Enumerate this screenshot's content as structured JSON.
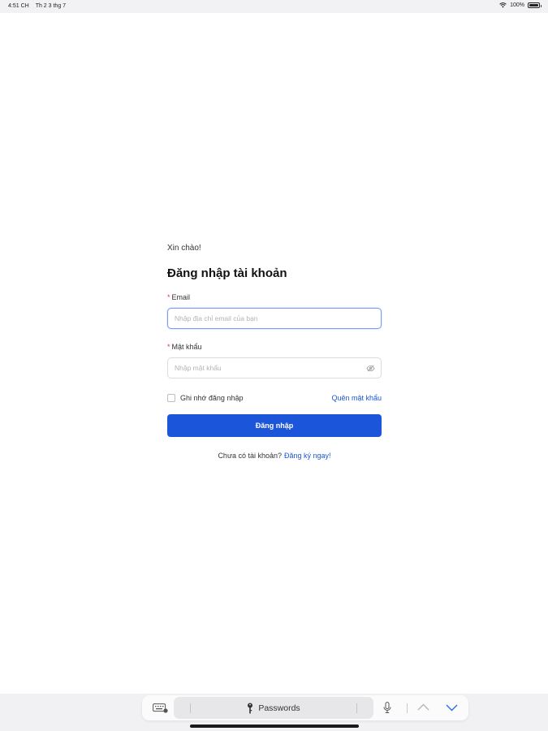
{
  "status_bar": {
    "time": "4:51 CH",
    "date": "Th 2 3 thg 7",
    "battery": "100%",
    "icons": [
      "wifi-icon",
      "battery-icon"
    ]
  },
  "login": {
    "greeting": "Xin chào!",
    "title": "Đăng nhập tài khoản",
    "email_label": "Email",
    "email_placeholder": "Nhập địa chỉ email của bạn",
    "email_value": "",
    "password_label": "Mật khẩu",
    "password_placeholder": "Nhập mật khẩu",
    "password_value": "",
    "required_marker": "*",
    "remember_label": "Ghi nhớ đăng nhập",
    "remember_checked": false,
    "forgot_label": "Quên mật khẩu",
    "submit_label": "Đăng nhập",
    "signup_prompt": "Chưa có tài khoản?",
    "signup_link": "Đăng ký ngay!",
    "accent_color": "#1b55d9",
    "required_color": "#e53935"
  },
  "keyboard_bar": {
    "passwords_label": "Passwords",
    "icons": [
      "keyboard-icon",
      "key-icon",
      "microphone-icon",
      "chevron-up-icon",
      "chevron-down-icon"
    ]
  }
}
